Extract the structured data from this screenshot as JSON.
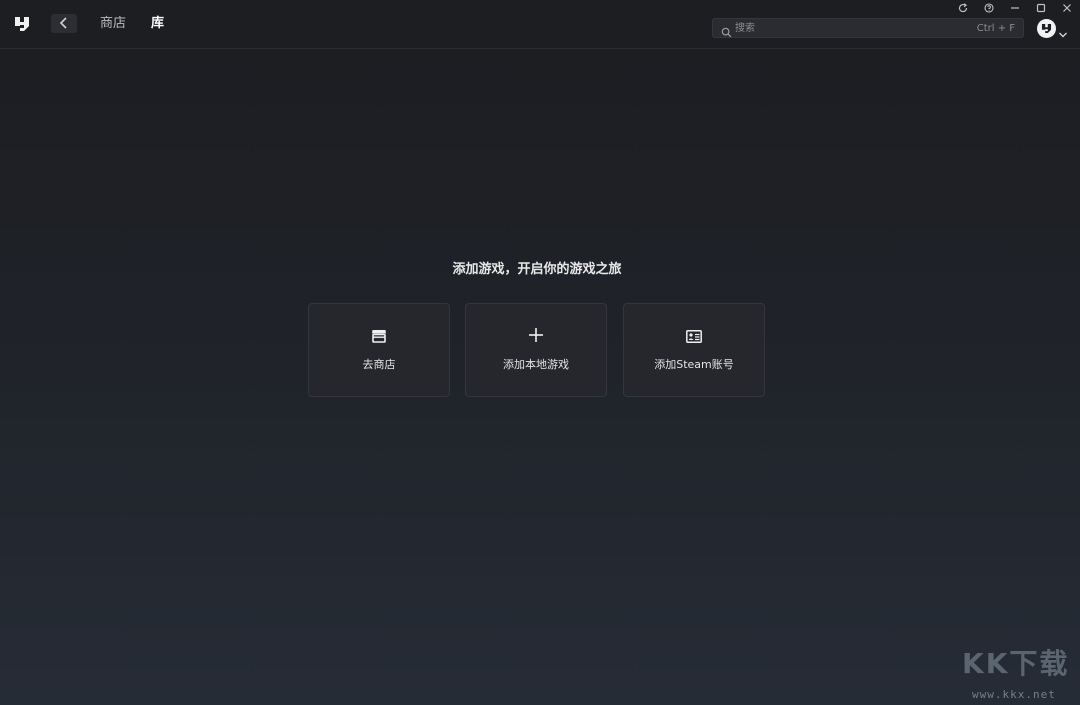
{
  "header": {
    "nav": {
      "store": "商店",
      "library": "库"
    },
    "active_tab": "库"
  },
  "search": {
    "placeholder": "搜索",
    "value": "",
    "shortcut": "Ctrl + F"
  },
  "window_controls": [
    "refresh-icon",
    "help-icon",
    "minimize-icon",
    "maximize-icon",
    "close-icon"
  ],
  "main": {
    "empty_title": "添加游戏，开启你的游戏之旅",
    "cards": [
      {
        "label": "去商店",
        "icon": "store-icon"
      },
      {
        "label": "添加本地游戏",
        "icon": "plus-icon"
      },
      {
        "label": "添加Steam账号",
        "icon": "id-card-icon"
      }
    ]
  },
  "watermark": {
    "glyphs": "KK下载",
    "url": "www.kkx.net"
  },
  "colors": {
    "background_top": "#1c1d21",
    "background_bottom": "#262c36",
    "card_bg": "#25272c",
    "text_primary": "#e8e8e8",
    "text_muted": "#8a8d92"
  }
}
